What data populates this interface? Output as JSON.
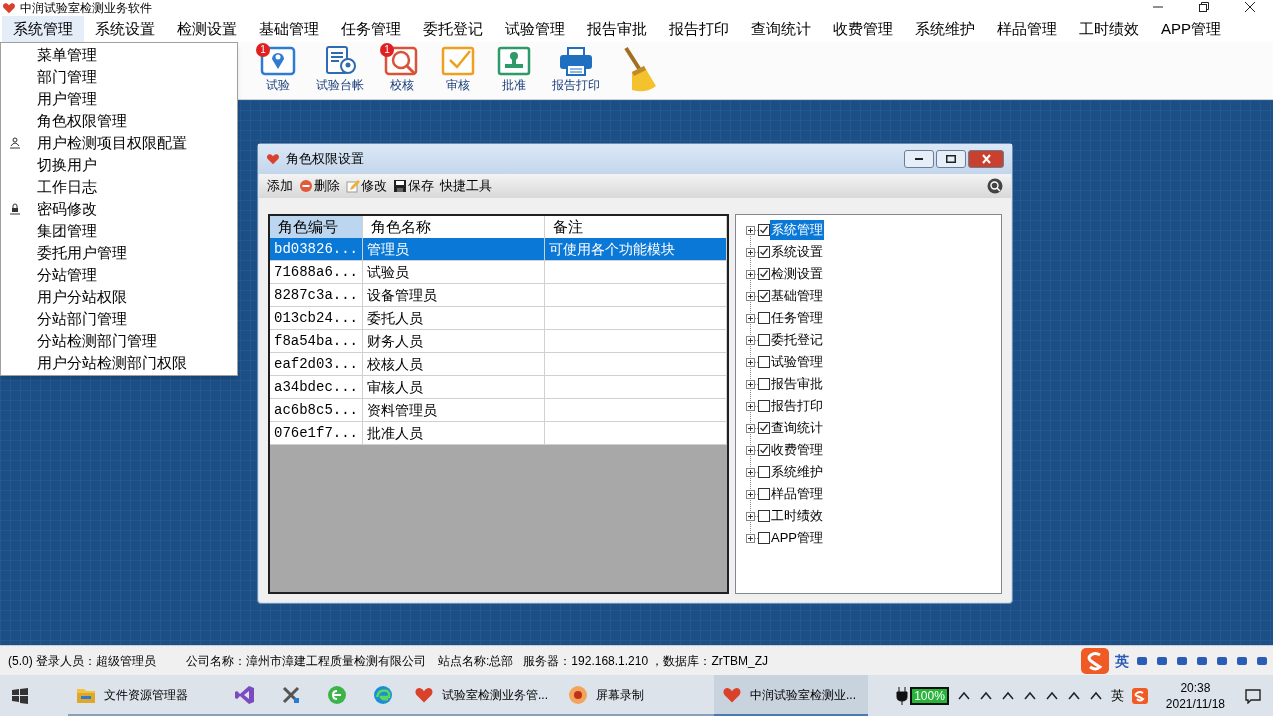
{
  "window": {
    "title": "中润试验室检测业务软件"
  },
  "menu_bar": [
    {
      "label": "系统管理",
      "selected": true
    },
    {
      "label": "系统设置",
      "selected": false
    },
    {
      "label": "检测设置",
      "selected": false
    },
    {
      "label": "基础管理",
      "selected": false
    },
    {
      "label": "任务管理",
      "selected": false
    },
    {
      "label": "委托登记",
      "selected": false
    },
    {
      "label": "试验管理",
      "selected": false
    },
    {
      "label": "报告审批",
      "selected": false
    },
    {
      "label": "报告打印",
      "selected": false
    },
    {
      "label": "查询统计",
      "selected": false
    },
    {
      "label": "收费管理",
      "selected": false
    },
    {
      "label": "系统维护",
      "selected": false
    },
    {
      "label": "样品管理",
      "selected": false
    },
    {
      "label": "工时绩效",
      "selected": false
    },
    {
      "label": "APP管理",
      "selected": false
    }
  ],
  "dropdown": [
    {
      "label": "菜单管理"
    },
    {
      "label": "部门管理"
    },
    {
      "label": "用户管理"
    },
    {
      "label": "角色权限管理"
    },
    {
      "label": "用户检测项目权限配置",
      "kind": "person"
    },
    {
      "label": "切换用户"
    },
    {
      "label": "工作日志"
    },
    {
      "label": "密码修改",
      "kind": "lock"
    },
    {
      "label": "集团管理"
    },
    {
      "label": "委托用户管理"
    },
    {
      "label": "分站管理"
    },
    {
      "label": "用户分站权限"
    },
    {
      "label": "分站部门管理"
    },
    {
      "label": "分站检测部门管理"
    },
    {
      "label": "用户分站检测部门权限"
    }
  ],
  "toolbar": [
    {
      "label": "试验",
      "kind": "pin",
      "badge": "1"
    },
    {
      "label": "试验台帐",
      "kind": "ledger"
    },
    {
      "label": "校核",
      "kind": "magnifier",
      "badge": "1"
    },
    {
      "label": "审核",
      "kind": "check"
    },
    {
      "label": "批准",
      "kind": "stamp"
    },
    {
      "label": "报告打印",
      "kind": "printer"
    },
    {
      "kind": "broom"
    }
  ],
  "dialog": {
    "title": "角色权限设置",
    "actions": [
      {
        "label": "添加"
      },
      {
        "label": "删除",
        "kind": "delete"
      },
      {
        "label": "修改",
        "kind": "edit"
      },
      {
        "label": "保存",
        "kind": "save"
      },
      {
        "label": "快捷工具"
      }
    ],
    "table": {
      "columns": [
        "角色编号",
        "角色名称",
        "备注"
      ],
      "rows": [
        {
          "cells": [
            "bd03826...",
            "管理员",
            "可使用各个功能模块"
          ],
          "selected": true
        },
        {
          "cells": [
            "71688a6...",
            "试验员",
            ""
          ],
          "selected": false
        },
        {
          "cells": [
            "8287c3a...",
            "设备管理员",
            ""
          ],
          "selected": false
        },
        {
          "cells": [
            "013cb24...",
            "委托人员",
            ""
          ],
          "selected": false
        },
        {
          "cells": [
            "f8a54ba...",
            "财务人员",
            ""
          ],
          "selected": false
        },
        {
          "cells": [
            "eaf2d03...",
            "校核人员",
            ""
          ],
          "selected": false
        },
        {
          "cells": [
            "a34bdec...",
            "审核人员",
            ""
          ],
          "selected": false
        },
        {
          "cells": [
            "ac6b8c5...",
            "资料管理员",
            ""
          ],
          "selected": false
        },
        {
          "cells": [
            "076e1f7...",
            "批准人员",
            ""
          ],
          "selected": false
        }
      ]
    },
    "tree": [
      {
        "label": "系统管理",
        "checked": true,
        "selected": true
      },
      {
        "label": "系统设置",
        "checked": true,
        "selected": false
      },
      {
        "label": "检测设置",
        "checked": true,
        "selected": false
      },
      {
        "label": "基础管理",
        "checked": true,
        "selected": false
      },
      {
        "label": "任务管理",
        "checked": false,
        "selected": false
      },
      {
        "label": "委托登记",
        "checked": false,
        "selected": false
      },
      {
        "label": "试验管理",
        "checked": false,
        "selected": false
      },
      {
        "label": "报告审批",
        "checked": false,
        "selected": false
      },
      {
        "label": "报告打印",
        "checked": false,
        "selected": false
      },
      {
        "label": "查询统计",
        "checked": true,
        "selected": false
      },
      {
        "label": "收费管理",
        "checked": true,
        "selected": false
      },
      {
        "label": "系统维护",
        "checked": false,
        "selected": false
      },
      {
        "label": "样品管理",
        "checked": false,
        "selected": false
      },
      {
        "label": "工时绩效",
        "checked": false,
        "selected": false
      },
      {
        "label": "APP管理",
        "checked": false,
        "selected": false
      }
    ]
  },
  "status_bar": [
    "(5.0) 登录人员：超级管理员",
    "公司名称：漳州市漳建工程质量检测有限公司",
    "站点名称:总部",
    "服务器：192.168.1.210 ，数据库：ZrTBM_ZJ"
  ],
  "ime_bar": {
    "language": "英"
  },
  "taskbar": {
    "apps": [
      {
        "label": "文件资源管理器",
        "kind": "folder",
        "active": false
      },
      {
        "kind": "vs",
        "active": false
      },
      {
        "kind": "tools",
        "active": false
      },
      {
        "kind": "green",
        "active": false
      },
      {
        "kind": "edge",
        "active": false
      },
      {
        "label": "试验室检测业务管...",
        "kind": "heart",
        "active": false
      },
      {
        "label": "屏幕录制",
        "kind": "recorder",
        "active": false
      },
      {
        "label": "中润试验室检测业...",
        "kind": "heart",
        "active": true
      }
    ],
    "battery": "100%",
    "input_lang": "英",
    "time": "20:38",
    "date": "2021/11/18"
  }
}
